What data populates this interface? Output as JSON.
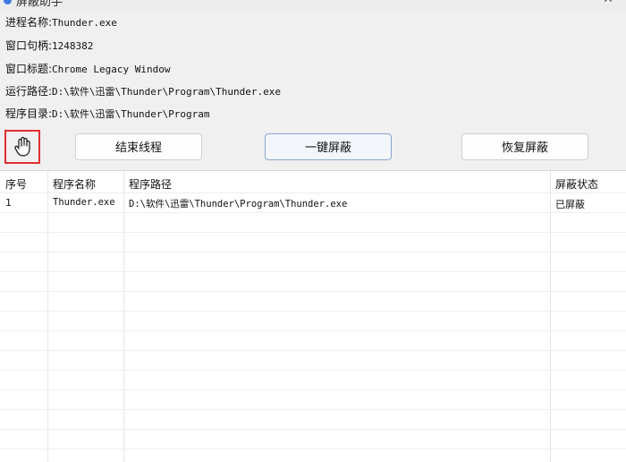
{
  "window": {
    "title": "屏蔽助手",
    "minimize_glyph": "—",
    "close_glyph": "✕"
  },
  "info": {
    "process_name_label": "进程名称:",
    "process_name_value": "Thunder.exe",
    "window_handle_label": "窗口句柄:",
    "window_handle_value": "1248382",
    "window_title_label": "窗口标题:",
    "window_title_value": "Chrome Legacy Window",
    "run_path_label": "运行路径:",
    "run_path_value": "D:\\软件\\迅雷\\Thunder\\Program\\Thunder.exe",
    "program_dir_label": "程序目录:",
    "program_dir_value": "D:\\软件\\迅雷\\Thunder\\Program"
  },
  "toolbar": {
    "picker_icon": "hand-pointer-icon",
    "end_thread_label": "结束线程",
    "shield_label": "一键屏蔽",
    "restore_label": "恢复屏蔽"
  },
  "table": {
    "headers": {
      "index": "序号",
      "name": "程序名称",
      "path": "程序路径",
      "status": "屏蔽状态"
    },
    "rows": [
      {
        "index": "1",
        "name": "Thunder.exe",
        "path": "D:\\软件\\迅雷\\Thunder\\Program\\Thunder.exe",
        "status": "已屏蔽"
      }
    ]
  },
  "colors": {
    "highlight_border": "#e03030",
    "panel_bg": "#f0f0f0"
  }
}
